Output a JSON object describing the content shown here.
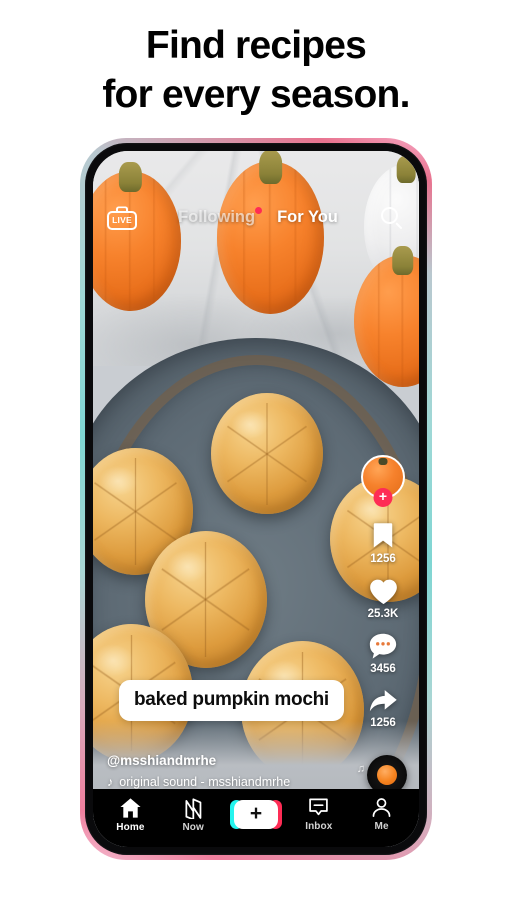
{
  "headline": {
    "line1": "Find recipes",
    "line2": "for every season."
  },
  "phone": {
    "topnav": {
      "live_label": "LIVE",
      "live_icon": "live-tv-icon",
      "tabs": [
        {
          "label": "Following",
          "active": false,
          "has_dot": true
        },
        {
          "label": "For You",
          "active": true,
          "has_dot": false
        }
      ],
      "search_icon": "search-icon"
    },
    "video": {
      "caption": "baked pumpkin mochi",
      "username": "@msshiandmrhe",
      "sound": "original sound - msshiandmrhe",
      "sound_icon": "music-note-icon",
      "disc_icon": "vinyl-record-icon",
      "notes_icon": "music-notes-icon"
    },
    "rail": {
      "avatar_icon": "avatar",
      "follow_label": "+",
      "items": [
        {
          "icon": "bookmark-icon",
          "count": "1256"
        },
        {
          "icon": "heart-icon",
          "count": "25.3K"
        },
        {
          "icon": "comment-icon",
          "count": "3456"
        },
        {
          "icon": "share-icon",
          "count": "1256"
        }
      ]
    },
    "tabbar": [
      {
        "label": "Home",
        "icon": "home-icon",
        "active": true
      },
      {
        "label": "Now",
        "icon": "now-icon",
        "active": false
      },
      {
        "label": "",
        "icon": "create-plus-icon",
        "active": false
      },
      {
        "label": "Inbox",
        "icon": "inbox-icon",
        "active": false
      },
      {
        "label": "Me",
        "icon": "profile-icon",
        "active": false
      }
    ]
  },
  "colors": {
    "accent_pink": "#fe2c55",
    "accent_cyan": "#25f4ee",
    "text_dark": "#010101",
    "bar_bg": "#000000"
  }
}
